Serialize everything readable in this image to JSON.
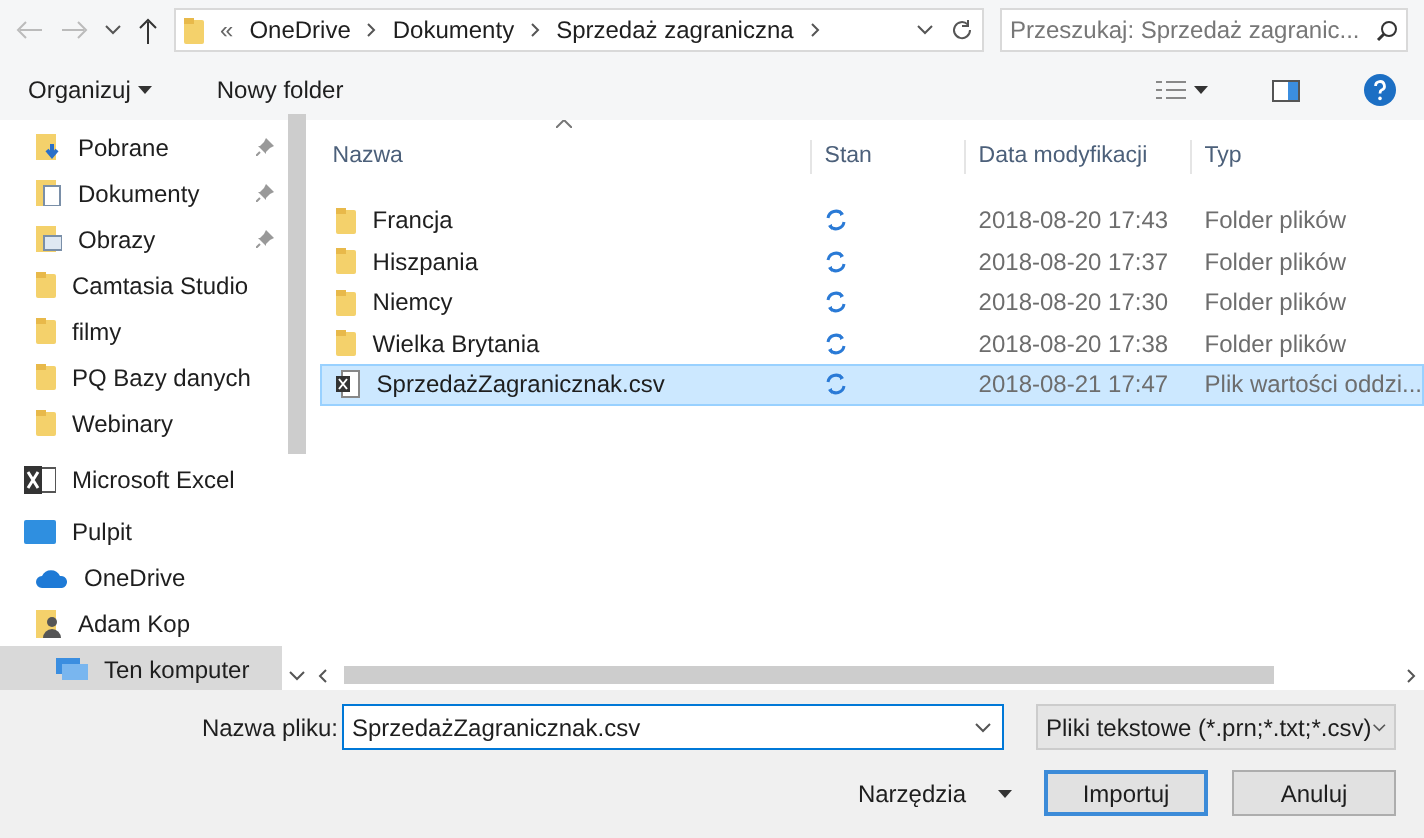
{
  "address_bar": {
    "crumbs": [
      "OneDrive",
      "Dokumenty",
      "Sprzedaż zagraniczna"
    ],
    "overflow": "«"
  },
  "search": {
    "placeholder": "Przeszukaj: Sprzedaż zagranic..."
  },
  "toolbar": {
    "organize": "Organizuj",
    "new_folder": "Nowy folder"
  },
  "sidebar": {
    "items": [
      {
        "label": "Pobrane",
        "kind": "download",
        "pinned": true,
        "selected": false
      },
      {
        "label": "Dokumenty",
        "kind": "document",
        "pinned": true,
        "selected": false
      },
      {
        "label": "Obrazy",
        "kind": "image",
        "pinned": true,
        "selected": false
      },
      {
        "label": "Camtasia Studio",
        "kind": "folder",
        "pinned": false,
        "selected": false
      },
      {
        "label": "filmy",
        "kind": "folder",
        "pinned": false,
        "selected": false
      },
      {
        "label": "PQ Bazy danych",
        "kind": "folder",
        "pinned": false,
        "selected": false
      },
      {
        "label": "Webinary",
        "kind": "folder",
        "pinned": false,
        "selected": false
      },
      {
        "label": "Microsoft Excel",
        "kind": "excel",
        "pinned": false,
        "selected": false
      },
      {
        "label": "Pulpit",
        "kind": "desktop",
        "pinned": false,
        "selected": false
      },
      {
        "label": "OneDrive",
        "kind": "cloud",
        "pinned": false,
        "selected": false
      },
      {
        "label": "Adam Kop",
        "kind": "user",
        "pinned": false,
        "selected": false
      },
      {
        "label": "Ten komputer",
        "kind": "computer",
        "pinned": false,
        "selected": true
      }
    ]
  },
  "table": {
    "columns": [
      "Nazwa",
      "Stan",
      "Data modyfikacji",
      "Typ"
    ],
    "rows": [
      {
        "name": "Francja",
        "kind": "folder",
        "date": "2018-08-20 17:43",
        "type": "Folder plików",
        "selected": false
      },
      {
        "name": "Hiszpania",
        "kind": "folder",
        "date": "2018-08-20 17:37",
        "type": "Folder plików",
        "selected": false
      },
      {
        "name": "Niemcy",
        "kind": "folder",
        "date": "2018-08-20 17:30",
        "type": "Folder plików",
        "selected": false
      },
      {
        "name": "Wielka Brytania",
        "kind": "folder",
        "date": "2018-08-20 17:38",
        "type": "Folder plików",
        "selected": false
      },
      {
        "name": "SprzedażZagranicznak.csv",
        "kind": "csv",
        "date": "2018-08-21 17:47",
        "type": "Plik wartości oddzi...",
        "selected": true
      }
    ]
  },
  "footer": {
    "filename_label": "Nazwa pliku:",
    "filename": "SprzedażZagranicznak.csv",
    "filter": "Pliki tekstowe (*.prn;*.txt;*.csv)",
    "tools": "Narzędzia",
    "import": "Importuj",
    "cancel": "Anuluj"
  }
}
